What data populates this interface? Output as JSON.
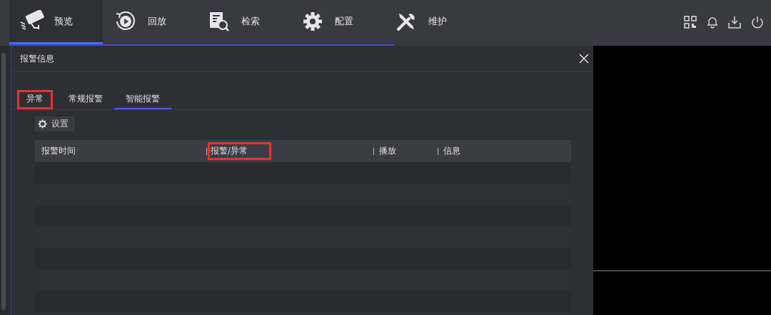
{
  "nav": {
    "items": [
      {
        "label": "预览",
        "selected": true
      },
      {
        "label": "回放",
        "selected": false
      },
      {
        "label": "检索",
        "selected": false
      },
      {
        "label": "配置",
        "selected": false
      },
      {
        "label": "维护",
        "selected": false
      }
    ]
  },
  "panel": {
    "title": "报警信息",
    "tabs": [
      {
        "label": "异常",
        "selected": false,
        "highlighted": true
      },
      {
        "label": "常规报警",
        "selected": false,
        "highlighted": false
      },
      {
        "label": "智能报警",
        "selected": true,
        "highlighted": false
      }
    ],
    "settings_button": "设置",
    "table": {
      "columns": [
        {
          "label": "报警时间",
          "highlighted": false
        },
        {
          "label": "报警/异常",
          "highlighted": true
        },
        {
          "label": "播放",
          "highlighted": false
        },
        {
          "label": "信息",
          "highlighted": false
        }
      ]
    }
  }
}
